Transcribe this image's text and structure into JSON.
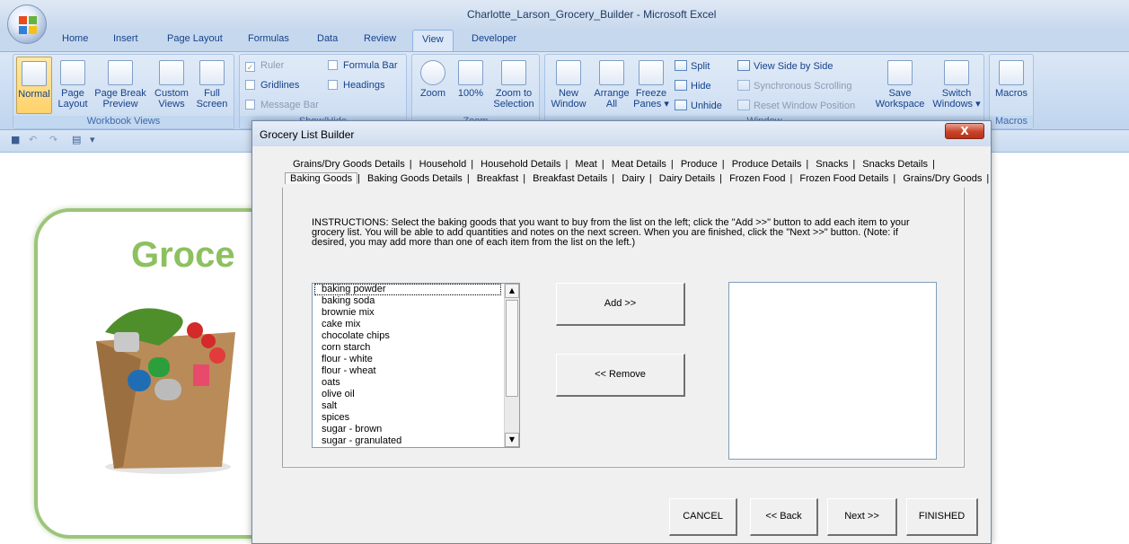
{
  "window": {
    "title": "Charlotte_Larson_Grocery_Builder - Microsoft Excel"
  },
  "ribbon_tabs": [
    "Home",
    "Insert",
    "Page Layout",
    "Formulas",
    "Data",
    "Review",
    "View",
    "Developer"
  ],
  "ribbon": {
    "workbook_views": {
      "label": "Workbook Views",
      "normal": "Normal",
      "page_layout_1": "Page",
      "page_layout_2": "Layout",
      "page_break_1": "Page Break",
      "page_break_2": "Preview",
      "custom_1": "Custom",
      "custom_2": "Views",
      "full_1": "Full",
      "full_2": "Screen"
    },
    "show_hide": {
      "label": "Show/Hide",
      "ruler": "Ruler",
      "gridlines": "Gridlines",
      "message_bar": "Message Bar",
      "formula_bar": "Formula Bar",
      "headings": "Headings"
    },
    "zoom": {
      "label": "Zoom",
      "zoom": "Zoom",
      "pct": "100%",
      "sel_1": "Zoom to",
      "sel_2": "Selection"
    },
    "window": {
      "label": "Window",
      "new_1": "New",
      "new_2": "Window",
      "arrange_1": "Arrange",
      "arrange_2": "All",
      "freeze_1": "Freeze",
      "freeze_2": "Panes ▾",
      "split": "Split",
      "hide": "Hide",
      "unhide": "Unhide",
      "side_by_side": "View Side by Side",
      "sync": "Synchronous Scrolling",
      "reset": "Reset Window Position",
      "save_1": "Save",
      "save_2": "Workspace",
      "switch_1": "Switch",
      "switch_2": "Windows ▾"
    },
    "macros": {
      "label": "Macros",
      "button": "Macros"
    }
  },
  "sheet": {
    "title": "Groce"
  },
  "dialog": {
    "title": "Grocery List Builder",
    "close": "X",
    "tabs_row1": [
      "Grains/Dry Goods Details",
      "Household",
      "Household Details",
      "Meat",
      "Meat Details",
      "Produce",
      "Produce Details",
      "Snacks",
      "Snacks Details"
    ],
    "tabs_row2": [
      "Baking Goods",
      "Baking Goods Details",
      "Breakfast",
      "Breakfast Details",
      "Dairy",
      "Dairy Details",
      "Frozen Food",
      "Frozen Food Details",
      "Grains/Dry Goods"
    ],
    "instructions": "INSTRUCTIONS: Select the baking goods that you want to buy from the list on the left; click the \"Add >>\" button to add each item to your grocery list. You will be able to add quantities and notes on the next screen. When you are finished, click the \"Next >>\" button. (Note: if desired, you may add more than one of each item from the list on the left.)",
    "items": [
      "baking powder",
      "baking soda",
      "brownie mix",
      "cake mix",
      "chocolate chips",
      "corn starch",
      "flour - white",
      "flour - wheat",
      "oats",
      "olive oil",
      "salt",
      "spices",
      "sugar - brown",
      "sugar - granulated"
    ],
    "add_button": "Add >>",
    "remove_button": "<< Remove",
    "cancel_button": "CANCEL",
    "back_button": "<< Back",
    "next_button": "Next >>",
    "finished_button": "FINISHED"
  }
}
